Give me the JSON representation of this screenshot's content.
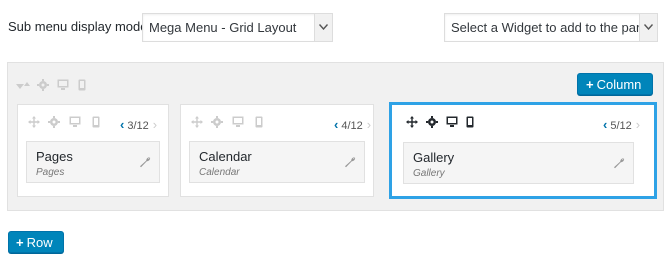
{
  "header": {
    "submenu_label": "Sub menu display mode",
    "mode_select_value": "Mega Menu - Grid Layout",
    "widget_select_value": "Select a Widget to add to the panel"
  },
  "toolbar": {
    "column_button_label": "Column",
    "row_button_label": "Row",
    "plus": "+"
  },
  "columns": [
    {
      "width": "3/12",
      "widget_title": "Pages",
      "widget_type": "Pages",
      "selected": false
    },
    {
      "width": "4/12",
      "widget_title": "Calendar",
      "widget_type": "Calendar",
      "selected": false
    },
    {
      "width": "5/12",
      "widget_title": "Gallery",
      "widget_type": "Gallery",
      "selected": true
    }
  ],
  "glyphs": {
    "left": "‹",
    "right": "›"
  },
  "colors": {
    "accent": "#0085ba",
    "selection": "#2ea2e6",
    "icon_dim": "#cccccc",
    "icon_dark": "#23282d"
  },
  "icons": [
    "move-icon",
    "gear-icon",
    "desktop-icon",
    "mobile-icon",
    "wrench-icon",
    "chevron-down-icon"
  ]
}
